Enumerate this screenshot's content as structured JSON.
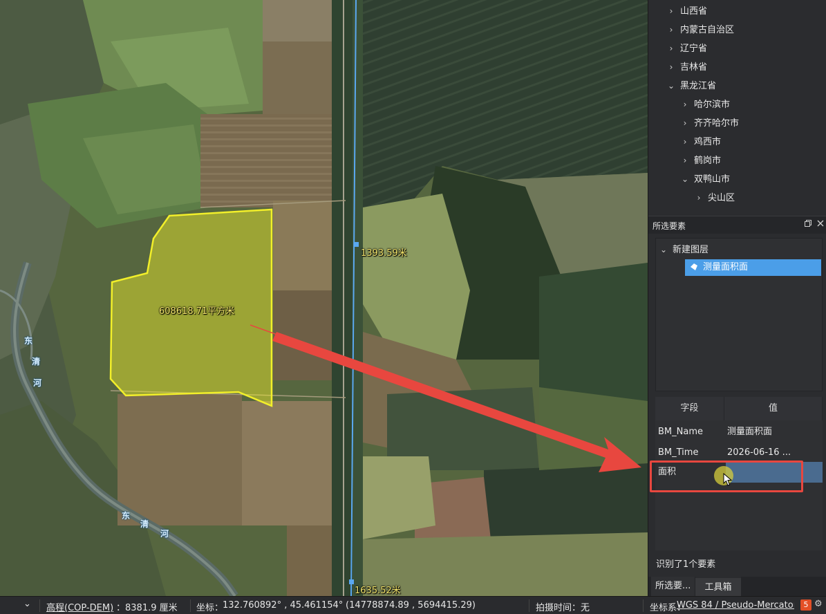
{
  "map": {
    "area_label": "608618.71平方米",
    "distance_label_1": "1393.59米",
    "distance_label_2": "1635.52米",
    "river_chars_left": [
      "东",
      "清",
      "河"
    ],
    "river_chars_bottom": [
      "东",
      "清",
      "河"
    ],
    "polygon_color": "#f2ef2a",
    "measure_line_color": "#5aa8f0",
    "arrow_color": "#e8473f"
  },
  "tree": {
    "items": [
      {
        "label": "山西省",
        "expanded": false,
        "level": 1
      },
      {
        "label": "内蒙古自治区",
        "expanded": false,
        "level": 1
      },
      {
        "label": "辽宁省",
        "expanded": false,
        "level": 1
      },
      {
        "label": "吉林省",
        "expanded": false,
        "level": 1
      },
      {
        "label": "黑龙江省",
        "expanded": true,
        "level": 1
      },
      {
        "label": "哈尔滨市",
        "expanded": false,
        "level": 2
      },
      {
        "label": "齐齐哈尔市",
        "expanded": false,
        "level": 2
      },
      {
        "label": "鸡西市",
        "expanded": false,
        "level": 2
      },
      {
        "label": "鹤岗市",
        "expanded": false,
        "level": 2
      },
      {
        "label": "双鸭山市",
        "expanded": true,
        "level": 2
      },
      {
        "label": "尖山区",
        "expanded": false,
        "level": 3
      }
    ]
  },
  "selection": {
    "title": "所选要素",
    "layer_name": "新建图层",
    "feature_name": "测量面积面",
    "table": {
      "headers": [
        "字段",
        "值"
      ],
      "rows": [
        {
          "field": "BM_Name",
          "value": "测量面积面"
        },
        {
          "field": "BM_Time",
          "value": "2026-06-16 ..."
        },
        {
          "field": "面积",
          "value": ""
        }
      ]
    },
    "count_text": "识别了1个要素",
    "tabs": [
      "所选要...",
      "工具箱"
    ]
  },
  "statusbar": {
    "elevation_label": "高程(COP-DEM)",
    "elevation_value": "：8381.9 厘米",
    "coord_label": "坐标：",
    "coord_value": "132.760892° , 45.461154°",
    "coord_projected": "(14778874.89 , 5694415.29)",
    "shot_time": "拍摄时间：无",
    "crs_label": "坐标系：",
    "crs_value": "WGS 84 / Pseudo-Mercator"
  }
}
